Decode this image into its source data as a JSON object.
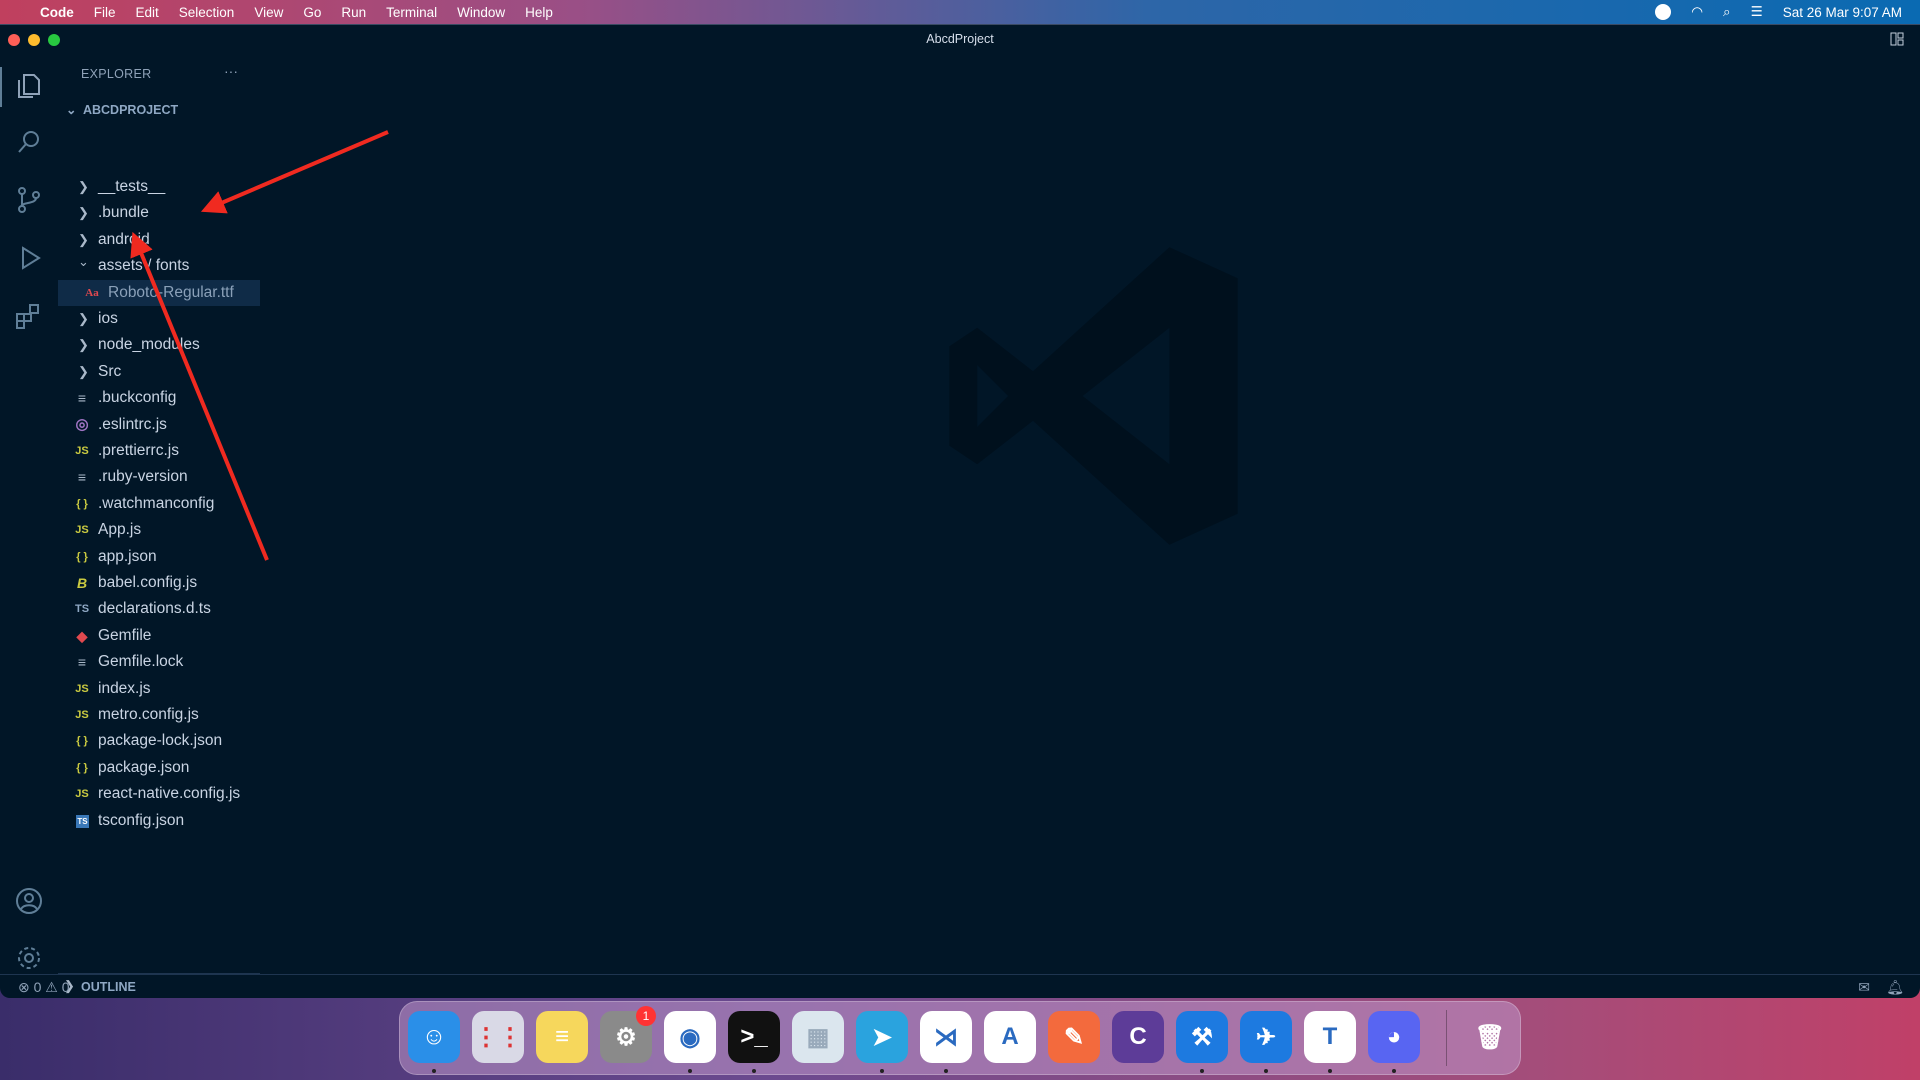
{
  "menubar": {
    "app": "Code",
    "items": [
      "File",
      "Edit",
      "Selection",
      "View",
      "Go",
      "Run",
      "Terminal",
      "Window",
      "Help"
    ],
    "clock": "Sat 26 Mar  9:07 AM"
  },
  "window": {
    "title": "AbcdProject"
  },
  "explorer": {
    "header": "EXPLORER",
    "more": "···",
    "project": "ABCDPROJECT",
    "outline": "OUTLINE",
    "items": [
      {
        "label": "__tests__",
        "type": "folder",
        "icon": "chevron-right"
      },
      {
        "label": ".bundle",
        "type": "folder",
        "icon": "chevron-right"
      },
      {
        "label": "android",
        "type": "folder",
        "icon": "chevron-right"
      },
      {
        "label": "assets / fonts",
        "type": "folder-open",
        "icon": "chevron-down"
      },
      {
        "label": "Roboto-Regular.ttf",
        "type": "font-file",
        "icon": "font-icon",
        "selected": true
      },
      {
        "label": "ios",
        "type": "folder",
        "icon": "chevron-right"
      },
      {
        "label": "node_modules",
        "type": "folder",
        "icon": "chevron-right"
      },
      {
        "label": "Src",
        "type": "folder",
        "icon": "chevron-right"
      },
      {
        "label": ".buckconfig",
        "type": "text-file",
        "icon": "lines-icon"
      },
      {
        "label": ".eslintrc.js",
        "type": "eslint-file",
        "icon": "eslint-icon"
      },
      {
        "label": ".prettierrc.js",
        "type": "js-file",
        "icon": "JS"
      },
      {
        "label": ".ruby-version",
        "type": "text-file",
        "icon": "lines-icon"
      },
      {
        "label": ".watchmanconfig",
        "type": "json-file",
        "icon": "{}"
      },
      {
        "label": "App.js",
        "type": "js-file",
        "icon": "JS"
      },
      {
        "label": "app.json",
        "type": "json-file",
        "icon": "{}"
      },
      {
        "label": "babel.config.js",
        "type": "babel-file",
        "icon": "babel-icon"
      },
      {
        "label": "declarations.d.ts",
        "type": "ts-file",
        "icon": "TS"
      },
      {
        "label": "Gemfile",
        "type": "ruby-file",
        "icon": "ruby-icon"
      },
      {
        "label": "Gemfile.lock",
        "type": "text-file",
        "icon": "lines-icon"
      },
      {
        "label": "index.js",
        "type": "js-file",
        "icon": "JS"
      },
      {
        "label": "metro.config.js",
        "type": "js-file",
        "icon": "JS"
      },
      {
        "label": "package-lock.json",
        "type": "json-file",
        "icon": "{}"
      },
      {
        "label": "package.json",
        "type": "json-file",
        "icon": "{}"
      },
      {
        "label": "react-native.config.js",
        "type": "js-file",
        "icon": "JS"
      },
      {
        "label": "tsconfig.json",
        "type": "tsconfig-file",
        "icon": "TS"
      }
    ]
  },
  "statusbar": {
    "errors": "0",
    "warnings": "0"
  },
  "dock": {
    "badge": "1",
    "apps": [
      "Finder",
      "Launchpad",
      "Notes",
      "System Preferences",
      "Chrome",
      "Terminal",
      "Simulator",
      "Telegram",
      "VS Code",
      "Android Studio",
      "Postman",
      "Cursor",
      "Xcode",
      "Transporter",
      "Teams",
      "Discord",
      "Trash"
    ]
  },
  "colors": {
    "background": "#011627",
    "accent_arrow": "#f02a20"
  }
}
